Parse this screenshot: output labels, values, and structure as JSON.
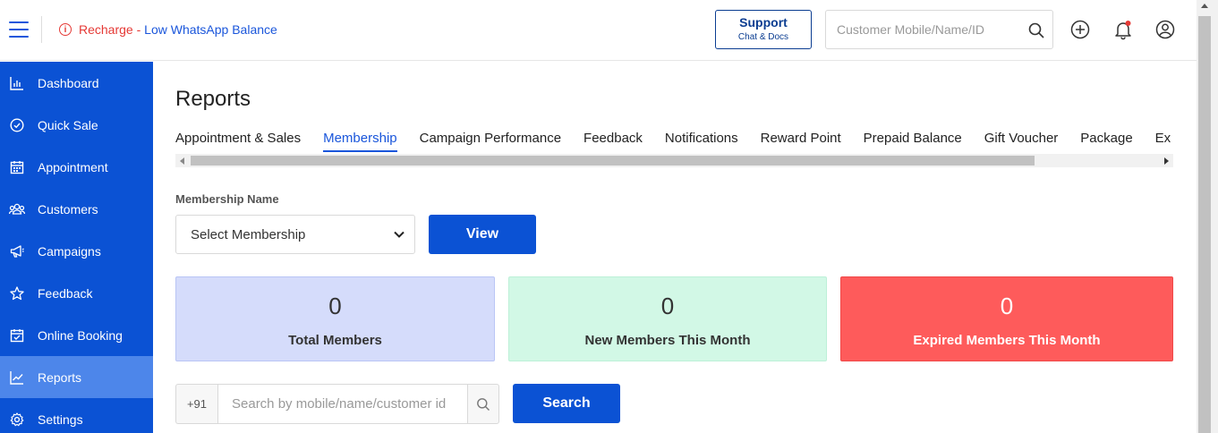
{
  "topbar": {
    "recharge_prefix": "Recharge - ",
    "recharge_link": "Low WhatsApp Balance",
    "support_title": "Support",
    "support_sub": "Chat & Docs",
    "search_placeholder": "Customer Mobile/Name/ID"
  },
  "sidebar": {
    "items": [
      {
        "label": "Dashboard",
        "icon": "bar-chart-icon"
      },
      {
        "label": "Quick Sale",
        "icon": "check-circle-icon"
      },
      {
        "label": "Appointment",
        "icon": "calendar-icon"
      },
      {
        "label": "Customers",
        "icon": "users-icon"
      },
      {
        "label": "Campaigns",
        "icon": "megaphone-icon"
      },
      {
        "label": "Feedback",
        "icon": "star-icon"
      },
      {
        "label": "Online Booking",
        "icon": "calendar-check-icon"
      },
      {
        "label": "Reports",
        "icon": "trend-chart-icon",
        "active": true
      },
      {
        "label": "Settings",
        "icon": "gear-icon"
      }
    ]
  },
  "main": {
    "title": "Reports",
    "tabs": [
      {
        "label": "Appointment & Sales"
      },
      {
        "label": "Membership",
        "active": true
      },
      {
        "label": "Campaign Performance"
      },
      {
        "label": "Feedback"
      },
      {
        "label": "Notifications"
      },
      {
        "label": "Reward Point"
      },
      {
        "label": "Prepaid Balance"
      },
      {
        "label": "Gift Voucher"
      },
      {
        "label": "Package"
      },
      {
        "label": "Ex"
      }
    ],
    "membership_label": "Membership Name",
    "membership_select": "Select Membership",
    "view_button": "View",
    "stats": [
      {
        "value": "0",
        "label": "Total Members"
      },
      {
        "value": "0",
        "label": "New Members This Month"
      },
      {
        "value": "0",
        "label": "Expired Members This Month"
      }
    ],
    "country_code": "+91",
    "customer_search_placeholder": "Search by mobile/name/customer id",
    "search_button": "Search"
  },
  "colors": {
    "primary": "#0b52d4",
    "sidebar_active": "#4d86ea",
    "alert": "#e53935",
    "stat_total": "#d5dcfb",
    "stat_new": "#d2f8e6",
    "stat_expired": "#fe5b5b"
  }
}
